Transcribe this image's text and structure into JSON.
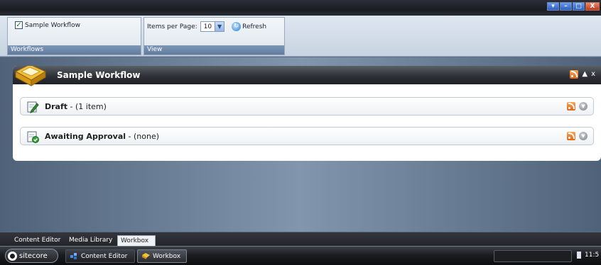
{
  "window": {
    "controls": [
      "▾",
      "–",
      "□",
      "X"
    ]
  },
  "ribbon": {
    "workflows_group": {
      "checkbox_label": "Sample Workflow",
      "checked": true,
      "caption": "Workflows"
    },
    "view_group": {
      "items_per_page_label": "Items per Page:",
      "items_per_page_value": "10",
      "refresh_label": "Refresh",
      "caption": "View"
    }
  },
  "workflow_panel": {
    "title": "Sample Workflow",
    "header_controls": [
      "▲",
      "x"
    ],
    "states": [
      {
        "name": "Draft",
        "count": " - (1 item)"
      },
      {
        "name": "Awaiting Approval",
        "count": " - (none)"
      }
    ]
  },
  "bottom_tabs": [
    {
      "label": "Content Editor",
      "active": false
    },
    {
      "label": "Media Library",
      "active": false
    },
    {
      "label": "Workbox",
      "active": true
    }
  ],
  "taskbar": {
    "start_label": "sitecore",
    "buttons": [
      {
        "label": "Content Editor",
        "active": false
      },
      {
        "label": "Workbox",
        "active": true
      }
    ],
    "clock": "11:5"
  },
  "colors": {
    "accent_rss": "#e0661c",
    "header_dark": "#2e3137",
    "ribbon_caption": "#5f7b9e"
  }
}
